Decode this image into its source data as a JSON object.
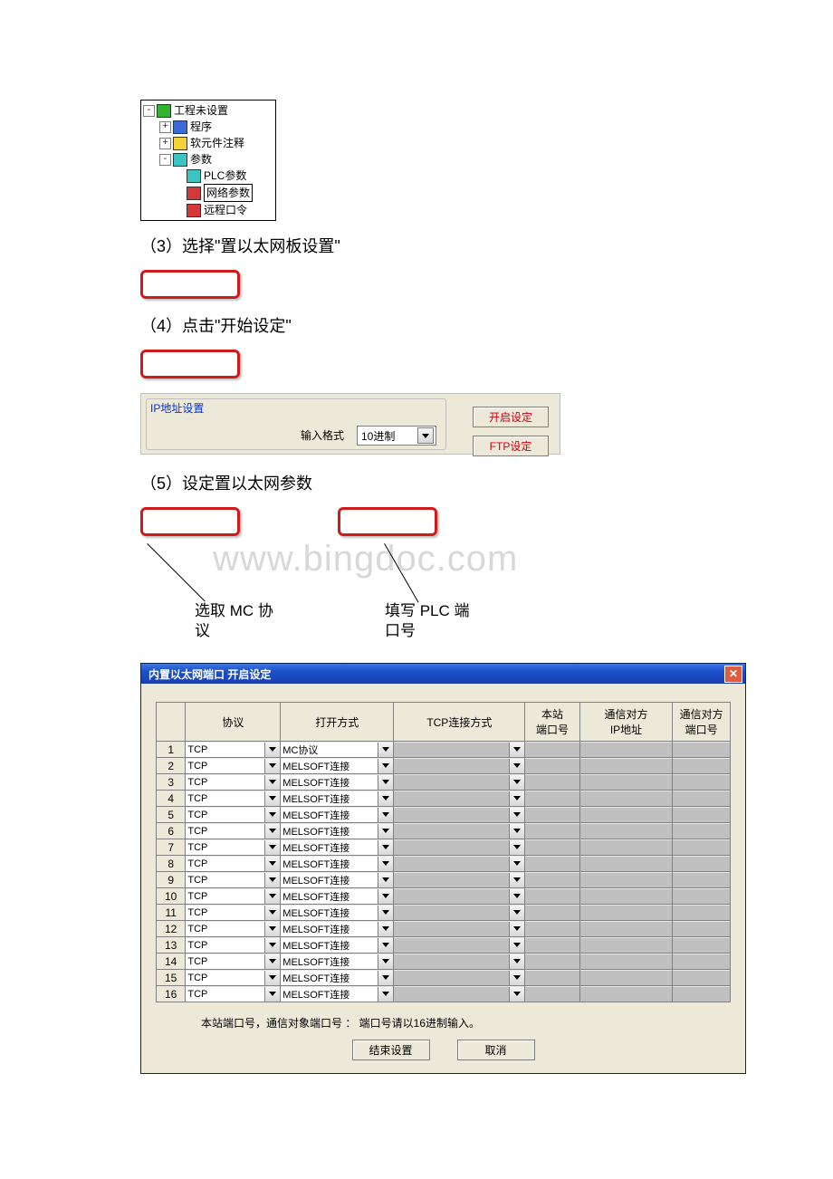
{
  "tree": {
    "root": "工程未设置",
    "items": [
      "程序",
      "软元件注释",
      "参数"
    ],
    "params": [
      "PLC参数",
      "网络参数",
      "远程口令"
    ]
  },
  "steps": {
    "s3": "（3）选择\"置以太网板设置\"",
    "s4": "（4）点击\"开始设定\"",
    "s5": "（5）设定置以太网参数"
  },
  "ip_panel": {
    "frame_label": "IP地址设置",
    "input_format_label": "输入格式",
    "input_format_value": "10进制",
    "open_btn": "开启设定",
    "ftp_btn": "FTP设定"
  },
  "sec5": {
    "left_label_1": "选取 MC 协",
    "left_label_2": "议",
    "right_label_1": "填写 PLC 端",
    "right_label_2": "口号",
    "watermark": "www.bingdoc.com"
  },
  "dialog": {
    "title": "内置以太网端口 开启设定",
    "headers": {
      "rownum": "",
      "protocol": "协议",
      "open_mode": "打开方式",
      "tcp_mode": "TCP连接方式",
      "local_port": "本站\n端口号",
      "remote_ip": "通信对方\nIP地址",
      "remote_port": "通信对方\n端口号"
    },
    "rows": [
      {
        "n": 1,
        "protocol": "TCP",
        "open": "MC协议"
      },
      {
        "n": 2,
        "protocol": "TCP",
        "open": "MELSOFT连接"
      },
      {
        "n": 3,
        "protocol": "TCP",
        "open": "MELSOFT连接"
      },
      {
        "n": 4,
        "protocol": "TCP",
        "open": "MELSOFT连接"
      },
      {
        "n": 5,
        "protocol": "TCP",
        "open": "MELSOFT连接"
      },
      {
        "n": 6,
        "protocol": "TCP",
        "open": "MELSOFT连接"
      },
      {
        "n": 7,
        "protocol": "TCP",
        "open": "MELSOFT连接"
      },
      {
        "n": 8,
        "protocol": "TCP",
        "open": "MELSOFT连接"
      },
      {
        "n": 9,
        "protocol": "TCP",
        "open": "MELSOFT连接"
      },
      {
        "n": 10,
        "protocol": "TCP",
        "open": "MELSOFT连接"
      },
      {
        "n": 11,
        "protocol": "TCP",
        "open": "MELSOFT连接"
      },
      {
        "n": 12,
        "protocol": "TCP",
        "open": "MELSOFT连接"
      },
      {
        "n": 13,
        "protocol": "TCP",
        "open": "MELSOFT连接"
      },
      {
        "n": 14,
        "protocol": "TCP",
        "open": "MELSOFT连接"
      },
      {
        "n": 15,
        "protocol": "TCP",
        "open": "MELSOFT连接"
      },
      {
        "n": 16,
        "protocol": "TCP",
        "open": "MELSOFT连接"
      }
    ],
    "footer_note": "本站端口号，通信对象端口号 ： 端口号请以16进制输入。",
    "ok_btn": "结束设置",
    "cancel_btn": "取消"
  }
}
